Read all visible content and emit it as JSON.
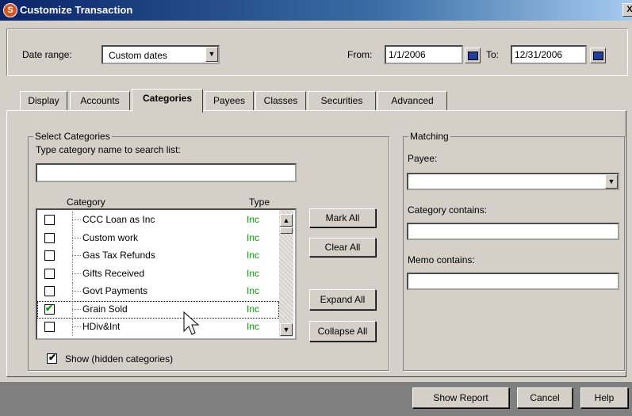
{
  "window": {
    "title": "Customize Transaction",
    "close": "X",
    "app_icon": "S"
  },
  "header": {
    "date_range_label": "Date range:",
    "date_range_value": "Custom dates",
    "from_label": "From:",
    "from_value": "1/1/2006",
    "to_label": "To:",
    "to_value": "12/31/2006"
  },
  "tabs": [
    {
      "label": "Display"
    },
    {
      "label": "Accounts"
    },
    {
      "label": "Categories"
    },
    {
      "label": "Payees"
    },
    {
      "label": "Classes"
    },
    {
      "label": "Securities"
    },
    {
      "label": "Advanced"
    }
  ],
  "active_tab": "Categories",
  "select_categories": {
    "title": "Select Categories",
    "search_label": "Type category name to search list:",
    "search_value": "",
    "col_category": "Category",
    "col_type": "Type",
    "rows": [
      {
        "name": "CCC Loan as Inc",
        "type": "Inc",
        "checked": false
      },
      {
        "name": "Custom work",
        "type": "Inc",
        "checked": false
      },
      {
        "name": "Gas Tax Refunds",
        "type": "Inc",
        "checked": false
      },
      {
        "name": "Gifts Received",
        "type": "Inc",
        "checked": false
      },
      {
        "name": "Govt Payments",
        "type": "Inc",
        "checked": false
      },
      {
        "name": "Grain Sold",
        "type": "Inc",
        "checked": true
      },
      {
        "name": "HDiv&Int",
        "type": "Inc",
        "checked": false
      }
    ],
    "mark_all": "Mark All",
    "clear_all": "Clear All",
    "expand_all": "Expand All",
    "collapse_all": "Collapse All",
    "show_hidden": "Show (hidden categories)",
    "show_hidden_checked": true
  },
  "matching": {
    "title": "Matching",
    "payee_label": "Payee:",
    "payee_value": "",
    "category_contains_label": "Category contains:",
    "category_contains_value": "",
    "memo_contains_label": "Memo contains:",
    "memo_contains_value": ""
  },
  "footer": {
    "show_report": "Show Report",
    "cancel": "Cancel",
    "help": "Help"
  },
  "colors": {
    "title_start": "#0a246a",
    "inc_green": "#00a000",
    "check_green": "#009900"
  }
}
